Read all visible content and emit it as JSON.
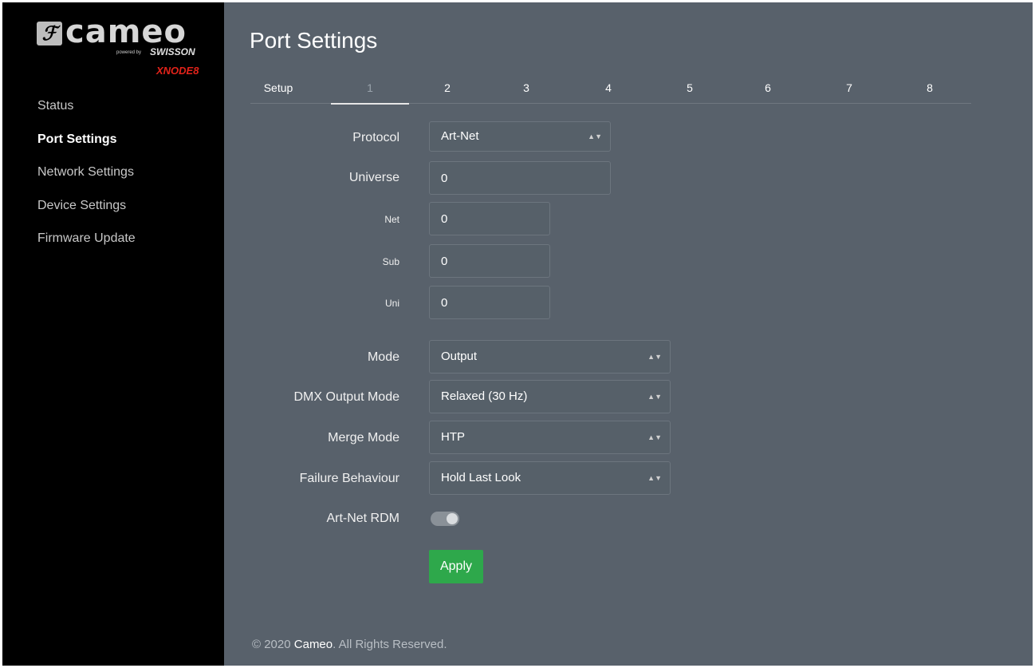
{
  "brand": {
    "logo_mark": "ℱ",
    "logo_word": "cameo",
    "powered_by": "powered by",
    "partner": "SWISSON",
    "model": "XNODE8"
  },
  "sidebar": {
    "items": [
      {
        "label": "Status"
      },
      {
        "label": "Port Settings",
        "active": true
      },
      {
        "label": "Network Settings"
      },
      {
        "label": "Device Settings"
      },
      {
        "label": "Firmware Update"
      }
    ]
  },
  "page": {
    "title": "Port Settings"
  },
  "tabs": [
    {
      "label": "Setup"
    },
    {
      "label": "1",
      "active": true
    },
    {
      "label": "2"
    },
    {
      "label": "3"
    },
    {
      "label": "4"
    },
    {
      "label": "5"
    },
    {
      "label": "6"
    },
    {
      "label": "7"
    },
    {
      "label": "8"
    }
  ],
  "form": {
    "protocol": {
      "label": "Protocol",
      "value": "Art-Net"
    },
    "universe": {
      "label": "Universe",
      "value": "0"
    },
    "net": {
      "label": "Net",
      "value": "0"
    },
    "sub": {
      "label": "Sub",
      "value": "0"
    },
    "uni": {
      "label": "Uni",
      "value": "0"
    },
    "mode": {
      "label": "Mode",
      "value": "Output"
    },
    "dmx_output_mode": {
      "label": "DMX Output Mode",
      "value": "Relaxed (30 Hz)"
    },
    "merge_mode": {
      "label": "Merge Mode",
      "value": "HTP"
    },
    "failure_behaviour": {
      "label": "Failure Behaviour",
      "value": "Hold Last Look"
    },
    "artnet_rdm": {
      "label": "Art-Net RDM",
      "enabled": true
    },
    "apply_label": "Apply"
  },
  "footer": {
    "prefix": "© 2020 ",
    "brand": "Cameo",
    "suffix": ". All Rights Reserved."
  },
  "colors": {
    "sidebar_bg": "#000000",
    "main_bg": "#58616b",
    "apply_green": "#2ea84b",
    "model_red": "#e2231a"
  }
}
